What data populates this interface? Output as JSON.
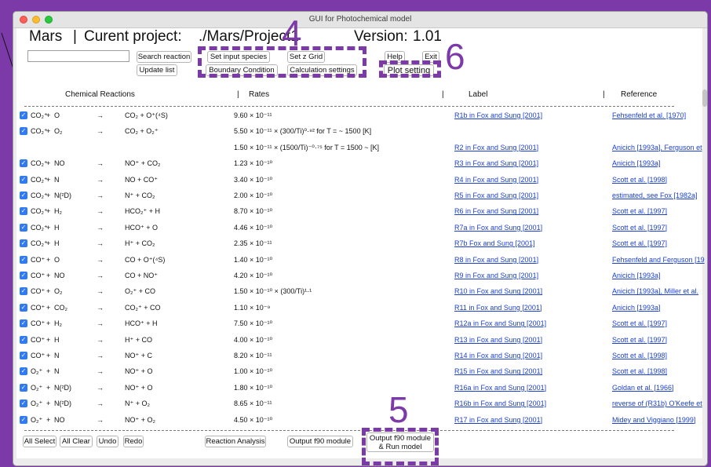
{
  "window": {
    "title": "GUI for Photochemical model"
  },
  "header": {
    "planet": "Mars",
    "separator": "|",
    "project_label": "Curent project:",
    "project_path": "./Mars/Project1",
    "version_label": "Version:",
    "version_value": "1.01"
  },
  "toolbar": {
    "search_placeholder": "",
    "search_reaction": "Search reaction",
    "update_list": "Update list",
    "set_input_species": "Set input species",
    "set_z_grid": "Set z Grid",
    "boundary_condition": "Boundary Condition",
    "calculation_settings": "Calculation settings",
    "help": "Help",
    "exit": "Exit",
    "plot_setting": "Plot setting"
  },
  "columns": {
    "chemical_reactions": "Chemical Reactions",
    "rates": "Rates",
    "label": "Label",
    "reference": "Reference",
    "sep": "|"
  },
  "check_glyph": "✓",
  "arrow": "→",
  "reactions": [
    {
      "checked": true,
      "r1": "CO₂⁺",
      "r2": "O",
      "products": "CO₂ + O⁺(⁴S)",
      "rate": "9.60 × 10⁻¹¹",
      "label": "R1b in Fox and Sung [2001]",
      "ref": "Fehsenfeld et al. [1970]"
    },
    {
      "checked": true,
      "r1": "CO₂⁺",
      "r2": "O₂",
      "products": "CO₂ + O₂⁺",
      "rate": "5.50 × 10⁻¹¹ × (300/Ti)⁰·⁸² for T = ~ 1500 [K]",
      "label": "",
      "ref": ""
    },
    {
      "checked": false,
      "r1": "",
      "r2": "",
      "products": "",
      "rate": "1.50 × 10⁻¹¹ × (1500/Ti)⁻⁰·⁷⁵ for T = 1500 ~ [K]",
      "label": "R2 in Fox and Sung [2001]",
      "ref": "Anicich [1993a], Ferguson et"
    },
    {
      "checked": true,
      "r1": "CO₂⁺",
      "r2": "NO",
      "products": "NO⁺ + CO₂",
      "rate": "1.23 × 10⁻¹⁰",
      "label": "R3 in Fox and Sung [2001]",
      "ref": "Anicich [1993a]"
    },
    {
      "checked": true,
      "r1": "CO₂⁺",
      "r2": "N",
      "products": "NO + CO⁺",
      "rate": "3.40 × 10⁻¹⁰",
      "label": "R4 in Fox and Sung [2001]",
      "ref": "Scott et al. [1998]"
    },
    {
      "checked": true,
      "r1": "CO₂⁺",
      "r2": "N(²D)",
      "products": "N⁺ + CO₂",
      "rate": "2.00 × 10⁻¹⁰",
      "label": "R5 in Fox and Sung [2001]",
      "ref": "estimated, see Fox [1982a]"
    },
    {
      "checked": true,
      "r1": "CO₂⁺",
      "r2": "H₂",
      "products": "HCO₂⁺ + H",
      "rate": "8.70 × 10⁻¹⁰",
      "label": "R6 in Fox and Sung [2001]",
      "ref": "Scott et al. [1997]"
    },
    {
      "checked": true,
      "r1": "CO₂⁺",
      "r2": "H",
      "products": "HCO⁺ + O",
      "rate": "4.46 × 10⁻¹⁰",
      "label": "R7a in Fox and Sung [2001]",
      "ref": "Scott et al. [1997]"
    },
    {
      "checked": true,
      "r1": "CO₂⁺",
      "r2": "H",
      "products": "H⁺ + CO₂",
      "rate": "2.35 × 10⁻¹¹",
      "label": "R7b Fox and Sung [2001]",
      "ref": "Scott et al. [1997]"
    },
    {
      "checked": true,
      "r1": "CO⁺",
      "r2": "O",
      "products": "CO + O⁺(⁴S)",
      "rate": "1.40 × 10⁻¹⁰",
      "label": "R8 in Fox and Sung [2001]",
      "ref": "Fehsenfeld and Ferguson [19"
    },
    {
      "checked": true,
      "r1": "CO⁺",
      "r2": "NO",
      "products": "CO + NO⁺",
      "rate": "4.20 × 10⁻¹⁰",
      "label": "R9 in Fox and Sung [2001]",
      "ref": "Anicich [1993a]"
    },
    {
      "checked": true,
      "r1": "CO⁺",
      "r2": "O₂",
      "products": "O₂⁺ + CO",
      "rate": "1.50 × 10⁻¹⁰ × (300/Ti)¹·¹",
      "label": "R10 in Fox and Sung [2001]",
      "ref": "Anicich [1993a], Miller et al."
    },
    {
      "checked": true,
      "r1": "CO⁺",
      "r2": "CO₂",
      "products": "CO₂⁺ + CO",
      "rate": "1.10 × 10⁻⁹",
      "label": "R11 in Fox and Sung [2001]",
      "ref": "Anicich [1993a]"
    },
    {
      "checked": true,
      "r1": "CO⁺",
      "r2": "H₂",
      "products": "HCO⁺ + H",
      "rate": "7.50 × 10⁻¹⁰",
      "label": "R12a in Fox and Sung [2001]",
      "ref": "Scott et al. [1997]"
    },
    {
      "checked": true,
      "r1": "CO⁺",
      "r2": "H",
      "products": "H⁺ + CO",
      "rate": "4.00 × 10⁻¹⁰",
      "label": "R13 in Fox and Sung [2001]",
      "ref": "Scott et al. [1997]"
    },
    {
      "checked": true,
      "r1": "CO⁺",
      "r2": "N",
      "products": "NO⁺ + C",
      "rate": "8.20 × 10⁻¹¹",
      "label": "R14 in Fox and Sung [2001]",
      "ref": "Scott et al. [1998]"
    },
    {
      "checked": true,
      "r1": "O₂⁺",
      "r2": "N",
      "products": "NO⁺ + O",
      "rate": "1.00 × 10⁻¹⁰",
      "label": "R15 in Fox and Sung [2001]",
      "ref": "Scott et al. [1998]"
    },
    {
      "checked": true,
      "r1": "O₂⁺",
      "r2": "N(²D)",
      "products": "NO⁺ + O",
      "rate": "1.80 × 10⁻¹⁰",
      "label": "R16a in Fox and Sung [2001]",
      "ref": "Goldan et al. [1966]"
    },
    {
      "checked": true,
      "r1": "O₂⁺",
      "r2": "N(²D)",
      "products": "N⁺ + O₂",
      "rate": "8.65 × 10⁻¹¹",
      "label": "R16b in Fox and Sung [2001]",
      "ref": "reverse of (R31b) O'Keefe et"
    },
    {
      "checked": true,
      "r1": "O₂⁺",
      "r2": "NO",
      "products": "NO⁺ + O₂",
      "rate": "4.50 × 10⁻¹⁰",
      "label": "R17 in Fox and Sung [2001]",
      "ref": "Midey and Viggiano [1999]"
    }
  ],
  "bottom": {
    "all_select": "All Select",
    "all_clear": "All Clear",
    "undo": "Undo",
    "redo": "Redo",
    "reaction_analysis": "Reaction Analysis",
    "output_f90": "Output f90 module",
    "output_run_line1": "Output f90 module",
    "output_run_line2": "& Run model"
  },
  "annotations": {
    "n4": "4",
    "n5": "5",
    "n6": "6",
    "color": "#7b3aa8"
  }
}
